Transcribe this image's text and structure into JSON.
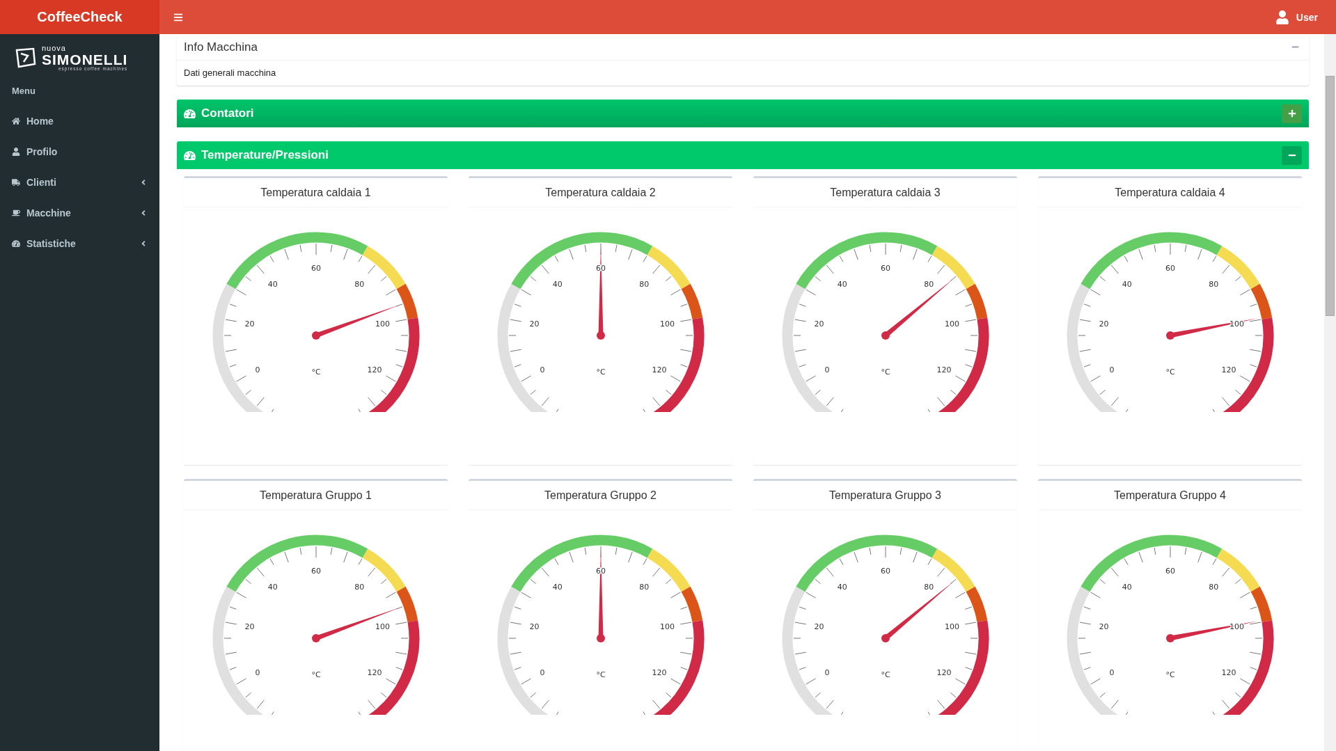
{
  "brand": "CoffeeCheck",
  "user": {
    "name": "User"
  },
  "logo": {
    "top": "nuova",
    "name": "SIMONELLI",
    "tagline": "espresso coffee machines"
  },
  "sidebar": {
    "header": "Menu",
    "items": [
      {
        "label": "Home",
        "expandable": false
      },
      {
        "label": "Profilo",
        "expandable": false
      },
      {
        "label": "Clienti",
        "expandable": true
      },
      {
        "label": "Macchine",
        "expandable": true
      },
      {
        "label": "Statistiche",
        "expandable": true
      }
    ]
  },
  "info_box": {
    "title": "Info Macchina",
    "body": "Dati generali macchina",
    "expanded": true
  },
  "panels": [
    {
      "title": "Contatori",
      "expanded": false
    },
    {
      "title": "Temperature/Pressioni",
      "expanded": true,
      "gauges": [
        {
          "title": "Temperatura caldaia 1",
          "unit": "°C",
          "labels": [
            "0",
            "20",
            "40",
            "60",
            "80",
            "100",
            "120"
          ],
          "level": 0.733
        },
        {
          "title": "Temperatura caldaia 2",
          "unit": "°C",
          "labels": [
            "0",
            "20",
            "40",
            "60",
            "80",
            "100",
            "120"
          ],
          "level": 0.5
        },
        {
          "title": "Temperatura caldaia 3",
          "unit": "°C",
          "labels": [
            "0",
            "20",
            "40",
            "60",
            "80",
            "100",
            "120"
          ],
          "level": 0.667
        },
        {
          "title": "Temperatura caldaia 4",
          "unit": "°C",
          "labels": [
            "0",
            "20",
            "40",
            "60",
            "80",
            "100",
            "120"
          ],
          "level": 0.763
        },
        {
          "title": "Temperatura Gruppo 1",
          "unit": "°C",
          "labels": [
            "0",
            "20",
            "40",
            "60",
            "80",
            "100",
            "120"
          ],
          "level": 0.733
        },
        {
          "title": "Temperatura Gruppo 2",
          "unit": "°C",
          "labels": [
            "0",
            "20",
            "40",
            "60",
            "80",
            "100",
            "120"
          ],
          "level": 0.5
        },
        {
          "title": "Temperatura Gruppo 3",
          "unit": "°C",
          "labels": [
            "0",
            "20",
            "40",
            "60",
            "80",
            "100",
            "120"
          ],
          "level": 0.667
        },
        {
          "title": "Temperatura Gruppo 4",
          "unit": "°C",
          "labels": [
            "0",
            "20",
            "40",
            "60",
            "80",
            "100",
            "120"
          ],
          "level": 0.763
        }
      ]
    }
  ]
}
